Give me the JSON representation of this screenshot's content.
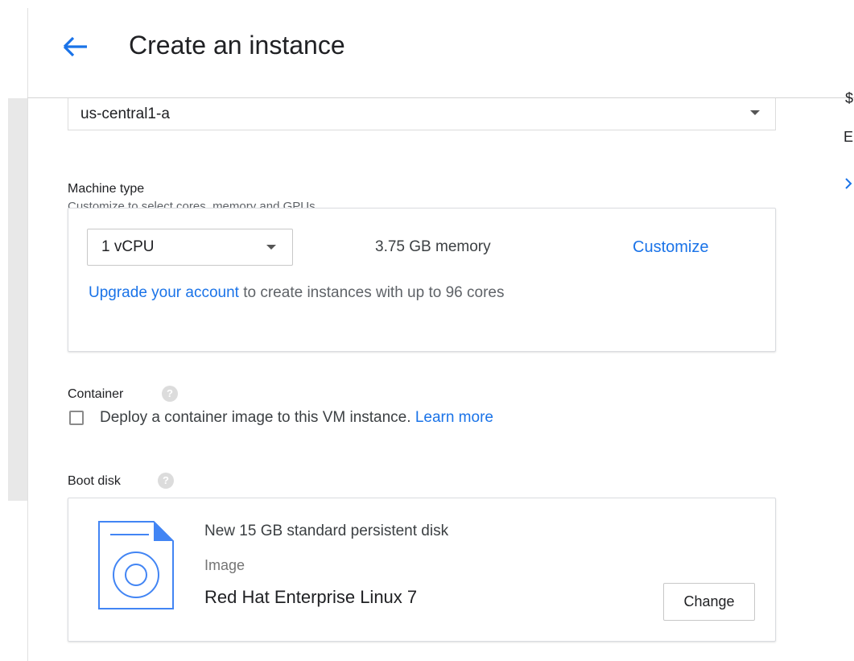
{
  "header": {
    "title": "Create an instance"
  },
  "zone": {
    "value": "us-central1-a"
  },
  "machine_type": {
    "label": "Machine type",
    "description": "Customize to select cores, memory and GPUs.",
    "cores_value": "1 vCPU",
    "memory": "3.75 GB memory",
    "customize_label": "Customize",
    "upgrade_link": "Upgrade your account",
    "upgrade_text": " to create instances with up to 96 cores"
  },
  "container": {
    "label": "Container",
    "checkbox_text": "Deploy a container image to this VM instance. ",
    "learn_more": "Learn more",
    "checked": false
  },
  "boot_disk": {
    "label": "Boot disk",
    "disk_desc": "New 15 GB standard persistent disk",
    "image_label": "Image",
    "image_name": "Red Hat Enterprise Linux 7",
    "change_label": "Change"
  },
  "right_panel": {
    "partial_letter_1": "$",
    "partial_letter_2": "E"
  },
  "colors": {
    "accent": "#1a73e8",
    "text": "#202124",
    "secondary_text": "#5f6368",
    "border": "#dadce0"
  },
  "icons": [
    "back-arrow-icon",
    "dropdown-caret-icon",
    "help-icon",
    "disk-image-icon",
    "chevron-icon"
  ]
}
